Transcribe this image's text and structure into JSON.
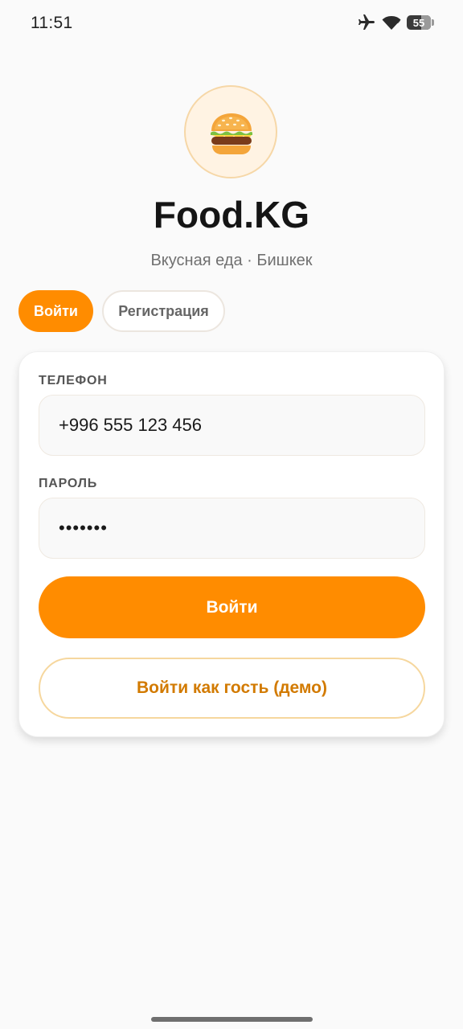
{
  "status_bar": {
    "time": "11:51",
    "battery_level": "55",
    "icons": [
      "airplane-mode-icon",
      "wifi-icon",
      "battery-icon"
    ]
  },
  "header": {
    "logo_icon": "burger-icon",
    "title": "Food.KG",
    "subtitle": "Вкусная еда · Бишкек"
  },
  "tabs": [
    {
      "label": "Войти",
      "active": true
    },
    {
      "label": "Регистрация",
      "active": false
    }
  ],
  "form": {
    "phone": {
      "label": "ТЕЛЕФОН",
      "value": "+996 555 123 456"
    },
    "password": {
      "label": "ПАРОЛЬ",
      "value": "•••••••"
    },
    "login_button": "Войти",
    "guest_button": "Войти как гость (демо)"
  },
  "colors": {
    "accent": "#ff8c00",
    "accent_dark": "#d27a00",
    "background": "#fafafa",
    "card": "#ffffff"
  }
}
